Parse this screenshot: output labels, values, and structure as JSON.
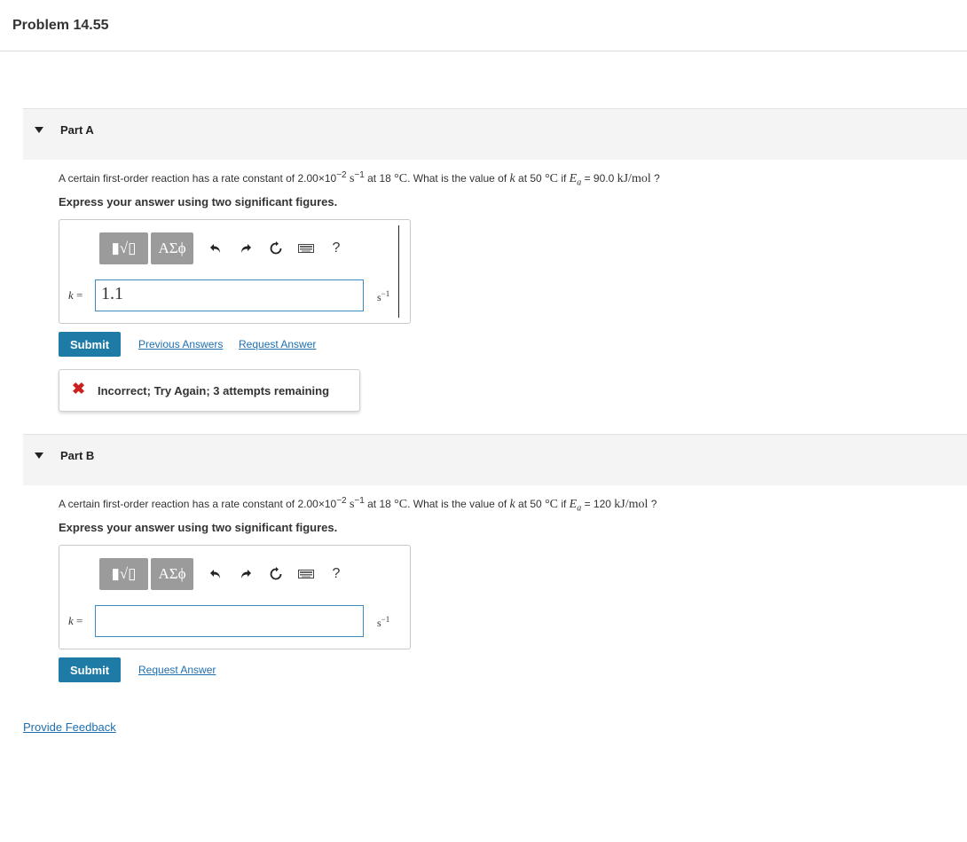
{
  "problem": {
    "title": "Problem 14.55"
  },
  "parts": [
    {
      "header": "Part A",
      "question": {
        "text1": "A certain first-order reaction has a rate constant of 2.00×10",
        "exp": "−2",
        "unit_s": "s",
        "unit_exp": "−1",
        "text2": " at 18 ",
        "temp1_unit": "°C",
        "text3": ". What is the value of ",
        "k": "k",
        "text4": " at 50 ",
        "temp2_unit": "°C",
        "text5": " if ",
        "ea": "E",
        "ea_sub": "a",
        "text6": " = 90.0 ",
        "ea_unit": "kJ/mol",
        "text7": " ?"
      },
      "instruction": "Express your answer using two significant figures.",
      "toolbar": {
        "template_label": "▮√▯",
        "greek_label": "ΑΣϕ",
        "help_label": "?"
      },
      "k_label_var": "k",
      "k_label_eq": " =",
      "input_value": "1.1",
      "unit": "s",
      "unit_exp": "−1",
      "submit_label": "Submit",
      "previous_answers_label": "Previous Answers",
      "request_answer_label": "Request Answer",
      "feedback": "Incorrect; Try Again; 3 attempts remaining"
    },
    {
      "header": "Part B",
      "question": {
        "text1": "A certain first-order reaction has a rate constant of 2.00×10",
        "exp": "−2",
        "unit_s": "s",
        "unit_exp": "−1",
        "text2": " at 18 ",
        "temp1_unit": "°C",
        "text3": ". What is the value of ",
        "k": "k",
        "text4": " at 50 ",
        "temp2_unit": "°C",
        "text5": " if ",
        "ea": "E",
        "ea_sub": "a",
        "text6": " = 120 ",
        "ea_unit": "kJ/mol",
        "text7": " ?"
      },
      "instruction": "Express your answer using two significant figures.",
      "toolbar": {
        "template_label": "▮√▯",
        "greek_label": "ΑΣϕ",
        "help_label": "?"
      },
      "k_label_var": "k",
      "k_label_eq": " =",
      "input_value": "",
      "unit": "s",
      "unit_exp": "−1",
      "submit_label": "Submit",
      "request_answer_label": "Request Answer"
    }
  ],
  "provide_feedback_label": "Provide Feedback",
  "icons": [
    "caret-down-icon",
    "undo-icon",
    "redo-icon",
    "reset-icon",
    "keyboard-icon",
    "help-icon",
    "incorrect-x-icon"
  ],
  "colors": {
    "accent": "#1e7ba6",
    "link": "#1e6fb0",
    "error": "#cc1f1f",
    "input_border": "#3c8abf"
  }
}
